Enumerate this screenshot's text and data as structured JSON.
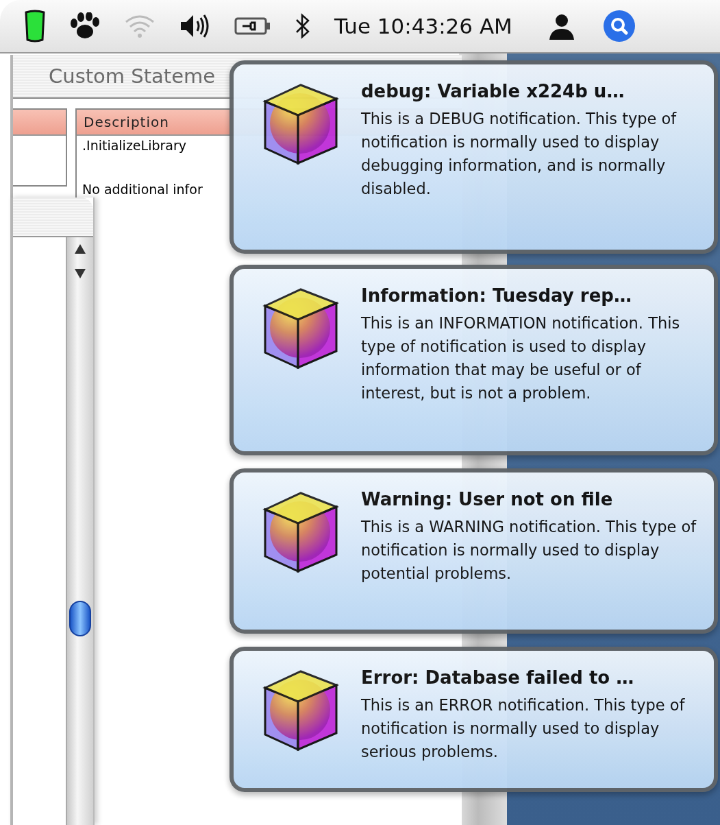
{
  "menu_bar": {
    "clock": "Tue 10:43:26 AM"
  },
  "back_window": {
    "title": "Custom Stateme",
    "description_header": "Description",
    "rows": [
      ".InitializeLibrary",
      "No additional infor"
    ]
  },
  "notifications": [
    {
      "title": "debug: Variable x224b u…",
      "body": "This is a DEBUG notification. This type of notification is normally used to display debugging information, and is normally disabled."
    },
    {
      "title": "Information: Tuesday rep…",
      "body": "This is an INFORMATION notification. This type of notification is used to display information that may be useful or of interest, but is not a problem."
    },
    {
      "title": "Warning: User not on file",
      "body": "This is a WARNING notification. This type of notification is normally used to display potential problems."
    },
    {
      "title": "Error: Database failed to …",
      "body": "This is an ERROR notification. This type of notification is normally used to display serious problems."
    }
  ]
}
